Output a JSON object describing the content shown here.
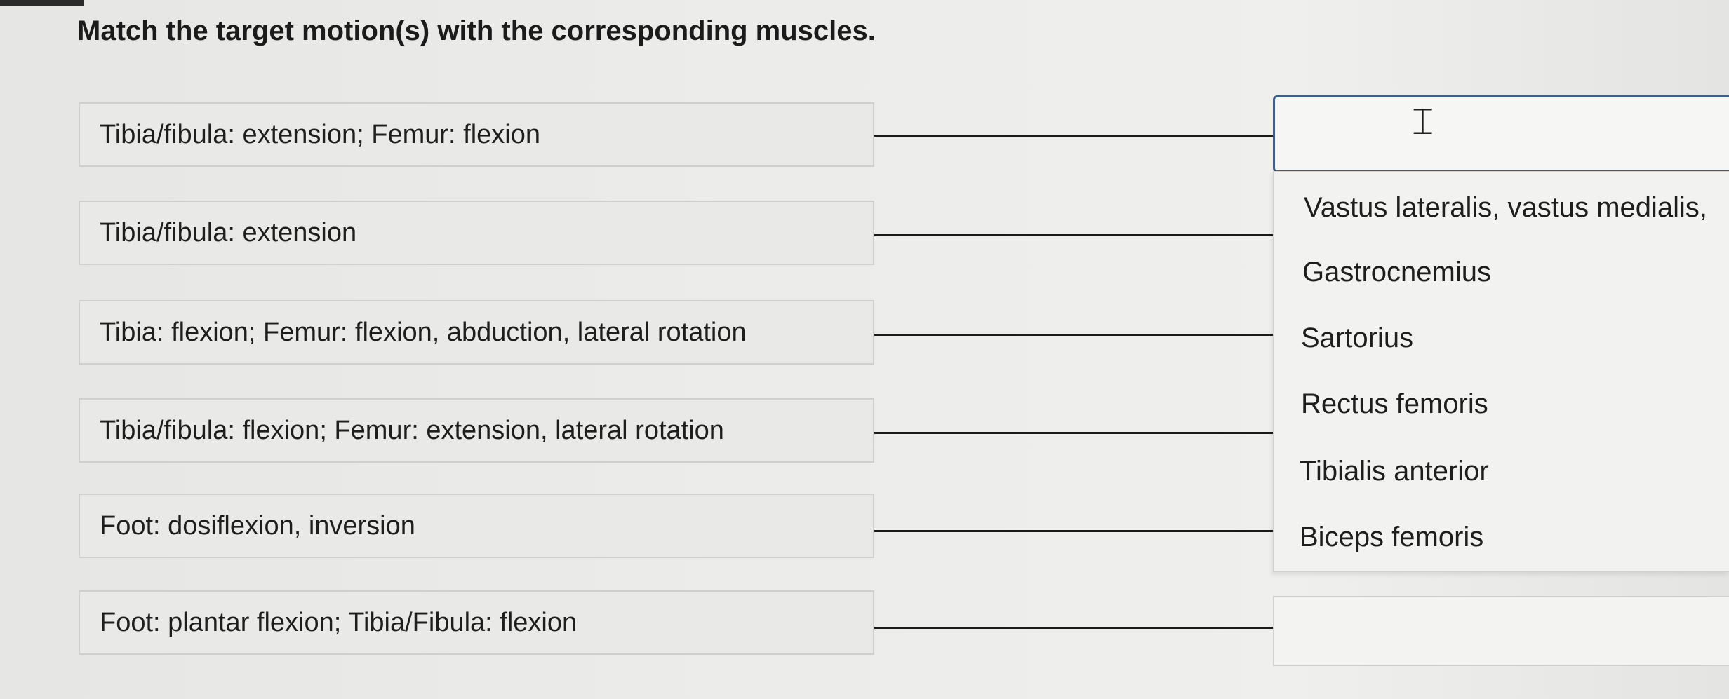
{
  "question": "Match the target motion(s) with the corresponding muscles.",
  "prompts": [
    "Tibia/fibula: extension; Femur: flexion",
    "Tibia/fibula: extension",
    "Tibia: flexion; Femur: flexion, abduction, lateral rotation",
    "Tibia/fibula: flexion; Femur: extension, lateral rotation",
    "Foot: dosiflexion, inversion",
    "Foot: plantar flexion; Tibia/Fibula: flexion"
  ],
  "dropdown_options": [
    "Vastus lateralis, vastus medialis,",
    "Gastrocnemius",
    "Sartorius",
    "Rectus femoris",
    "Tibialis anterior",
    "Biceps femoris"
  ],
  "active_slot_index": 0,
  "cursor_icon": "text-cursor-icon"
}
